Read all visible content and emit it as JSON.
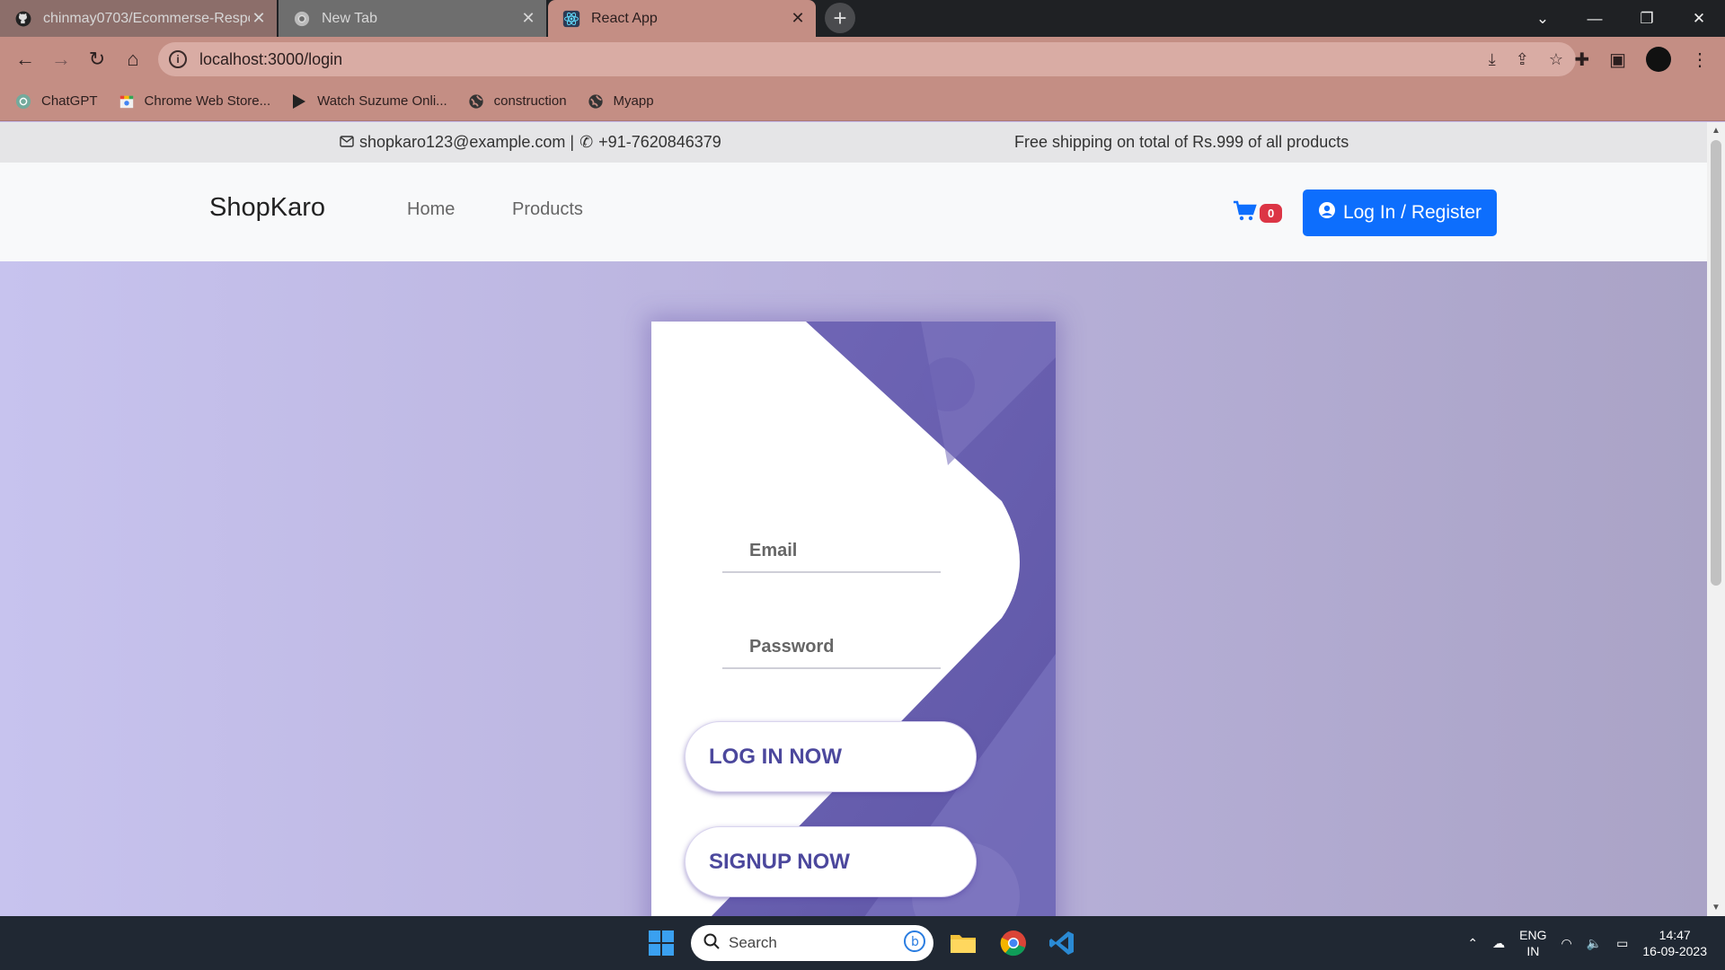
{
  "browser": {
    "tabs": [
      {
        "label": "chinmay0703/Ecommerse-Respo",
        "icon": "github-icon"
      },
      {
        "label": "New Tab",
        "icon": "chrome-icon"
      },
      {
        "label": "React App",
        "icon": "react-icon"
      }
    ],
    "url": "localhost:3000/login",
    "bookmarks": [
      {
        "label": "ChatGPT",
        "icon": "chatgpt-icon"
      },
      {
        "label": "Chrome Web Store...",
        "icon": "webstore-icon"
      },
      {
        "label": "Watch Suzume Onli...",
        "icon": "play-icon"
      },
      {
        "label": "construction",
        "icon": "globe-icon"
      },
      {
        "label": "Myapp",
        "icon": "globe-icon"
      }
    ]
  },
  "topbar": {
    "email": "shopkaro123@example.com |",
    "phone": "+91-7620846379",
    "shipping": "Free shipping on total of Rs.999 of all products"
  },
  "navbar": {
    "brand": "ShopKaro",
    "links": [
      "Home",
      "Products"
    ],
    "cart_count": "0",
    "login_label": "Log In / Register"
  },
  "login": {
    "email_placeholder": "Email",
    "password_placeholder": "Password",
    "login_button": "LOG IN NOW",
    "signup_button": "SIGNUP NOW"
  },
  "taskbar": {
    "search_placeholder": "Search",
    "lang_top": "ENG",
    "lang_bottom": "IN",
    "time": "14:47",
    "date": "16-09-2023"
  },
  "colors": {
    "accent": "#0d6efd",
    "card_purple": "#6a5fb0",
    "button_text": "#4c489d",
    "badge": "#dc3545"
  }
}
